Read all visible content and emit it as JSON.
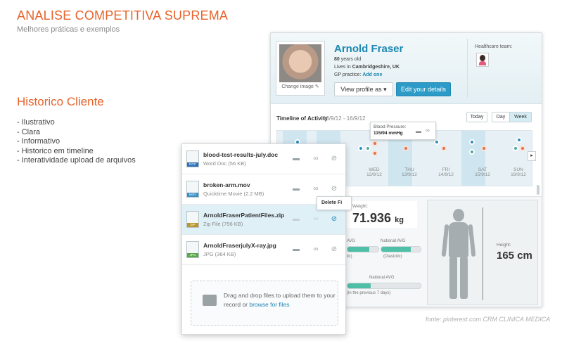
{
  "slide": {
    "title": "ANALISE COMPETITIVA SUPREMA",
    "subtitle": "Melhores práticas e exemplos",
    "section_title": "Historico Cliente",
    "bullets": [
      "- Ilustrativo",
      "- Clara",
      "- Informativo",
      "- Historico em timeline",
      "- Interatividade upload de arquivos"
    ],
    "credit": "fonte: pinterest.com CRM CLINICA MEDICA"
  },
  "profile": {
    "name": "Arnold Fraser",
    "age_value": "80",
    "age_suffix": " years old",
    "lives_prefix": "Lives in ",
    "lives_location": "Cambridgeshire, UK",
    "gp_prefix": "GP practice: ",
    "gp_link": "Add one",
    "change_image": "Change image ✎",
    "view_profile_button": "View profile as ▾",
    "edit_button": "Edit your details",
    "healthcare_team_label": "Healthcare team:"
  },
  "timeline": {
    "title": "Timeline of Activity",
    "range": "10/9/12 - 16/9/12",
    "today_button": "Today",
    "day_button": "Day",
    "week_button": "Week",
    "days": [
      {
        "name": "WED",
        "date": "12/9/12"
      },
      {
        "name": "THU",
        "date": "13/9/12"
      },
      {
        "name": "FRI",
        "date": "14/9/12"
      },
      {
        "name": "SAT",
        "date": "15/9/12"
      },
      {
        "name": "SUN",
        "date": "16/9/12"
      }
    ],
    "tooltip_title": "Blood Pressure:",
    "tooltip_value": "115/94 mmHg",
    "next_arrow": "▸"
  },
  "stats": {
    "weight_label": "Weight:",
    "weight_value": "71.936",
    "weight_unit": "kg",
    "national_avg_1": "National AVG",
    "national_avg_2": "National AVG",
    "diastolic": "(Diastolic)",
    "sic": "lic)",
    "avg_fragment": "AVG",
    "previous_days": "(in the previous 7 days)",
    "height_label": "Height:",
    "height_value": "165 cm"
  },
  "files": {
    "items": [
      {
        "name": "blood-test-results-july.doc",
        "meta": "Word Doc (56 KB)",
        "tag": "DOC",
        "color": "#2b6fb5"
      },
      {
        "name": "broken-arm.mov",
        "meta": "Quicktime Movie (2.2 MB)",
        "tag": "MOV",
        "color": "#3a8fc4"
      },
      {
        "name": "ArnoldFraserPatientFiles.zip",
        "meta": "Zip File (756 KB)",
        "tag": "ZIP",
        "color": "#b8962e"
      },
      {
        "name": "ArnoldFraserjulyX-ray.jpg",
        "meta": "JPG (364 KB)",
        "tag": "JPG",
        "color": "#5aa84a"
      }
    ],
    "delete_tooltip": "Delete Fi",
    "drop_text": "Drag and drop files to upload them to your record or ",
    "drop_link": "browse for files",
    "icons": {
      "comment": "comment-icon",
      "link": "link-icon",
      "delete": "delete-icon"
    }
  }
}
